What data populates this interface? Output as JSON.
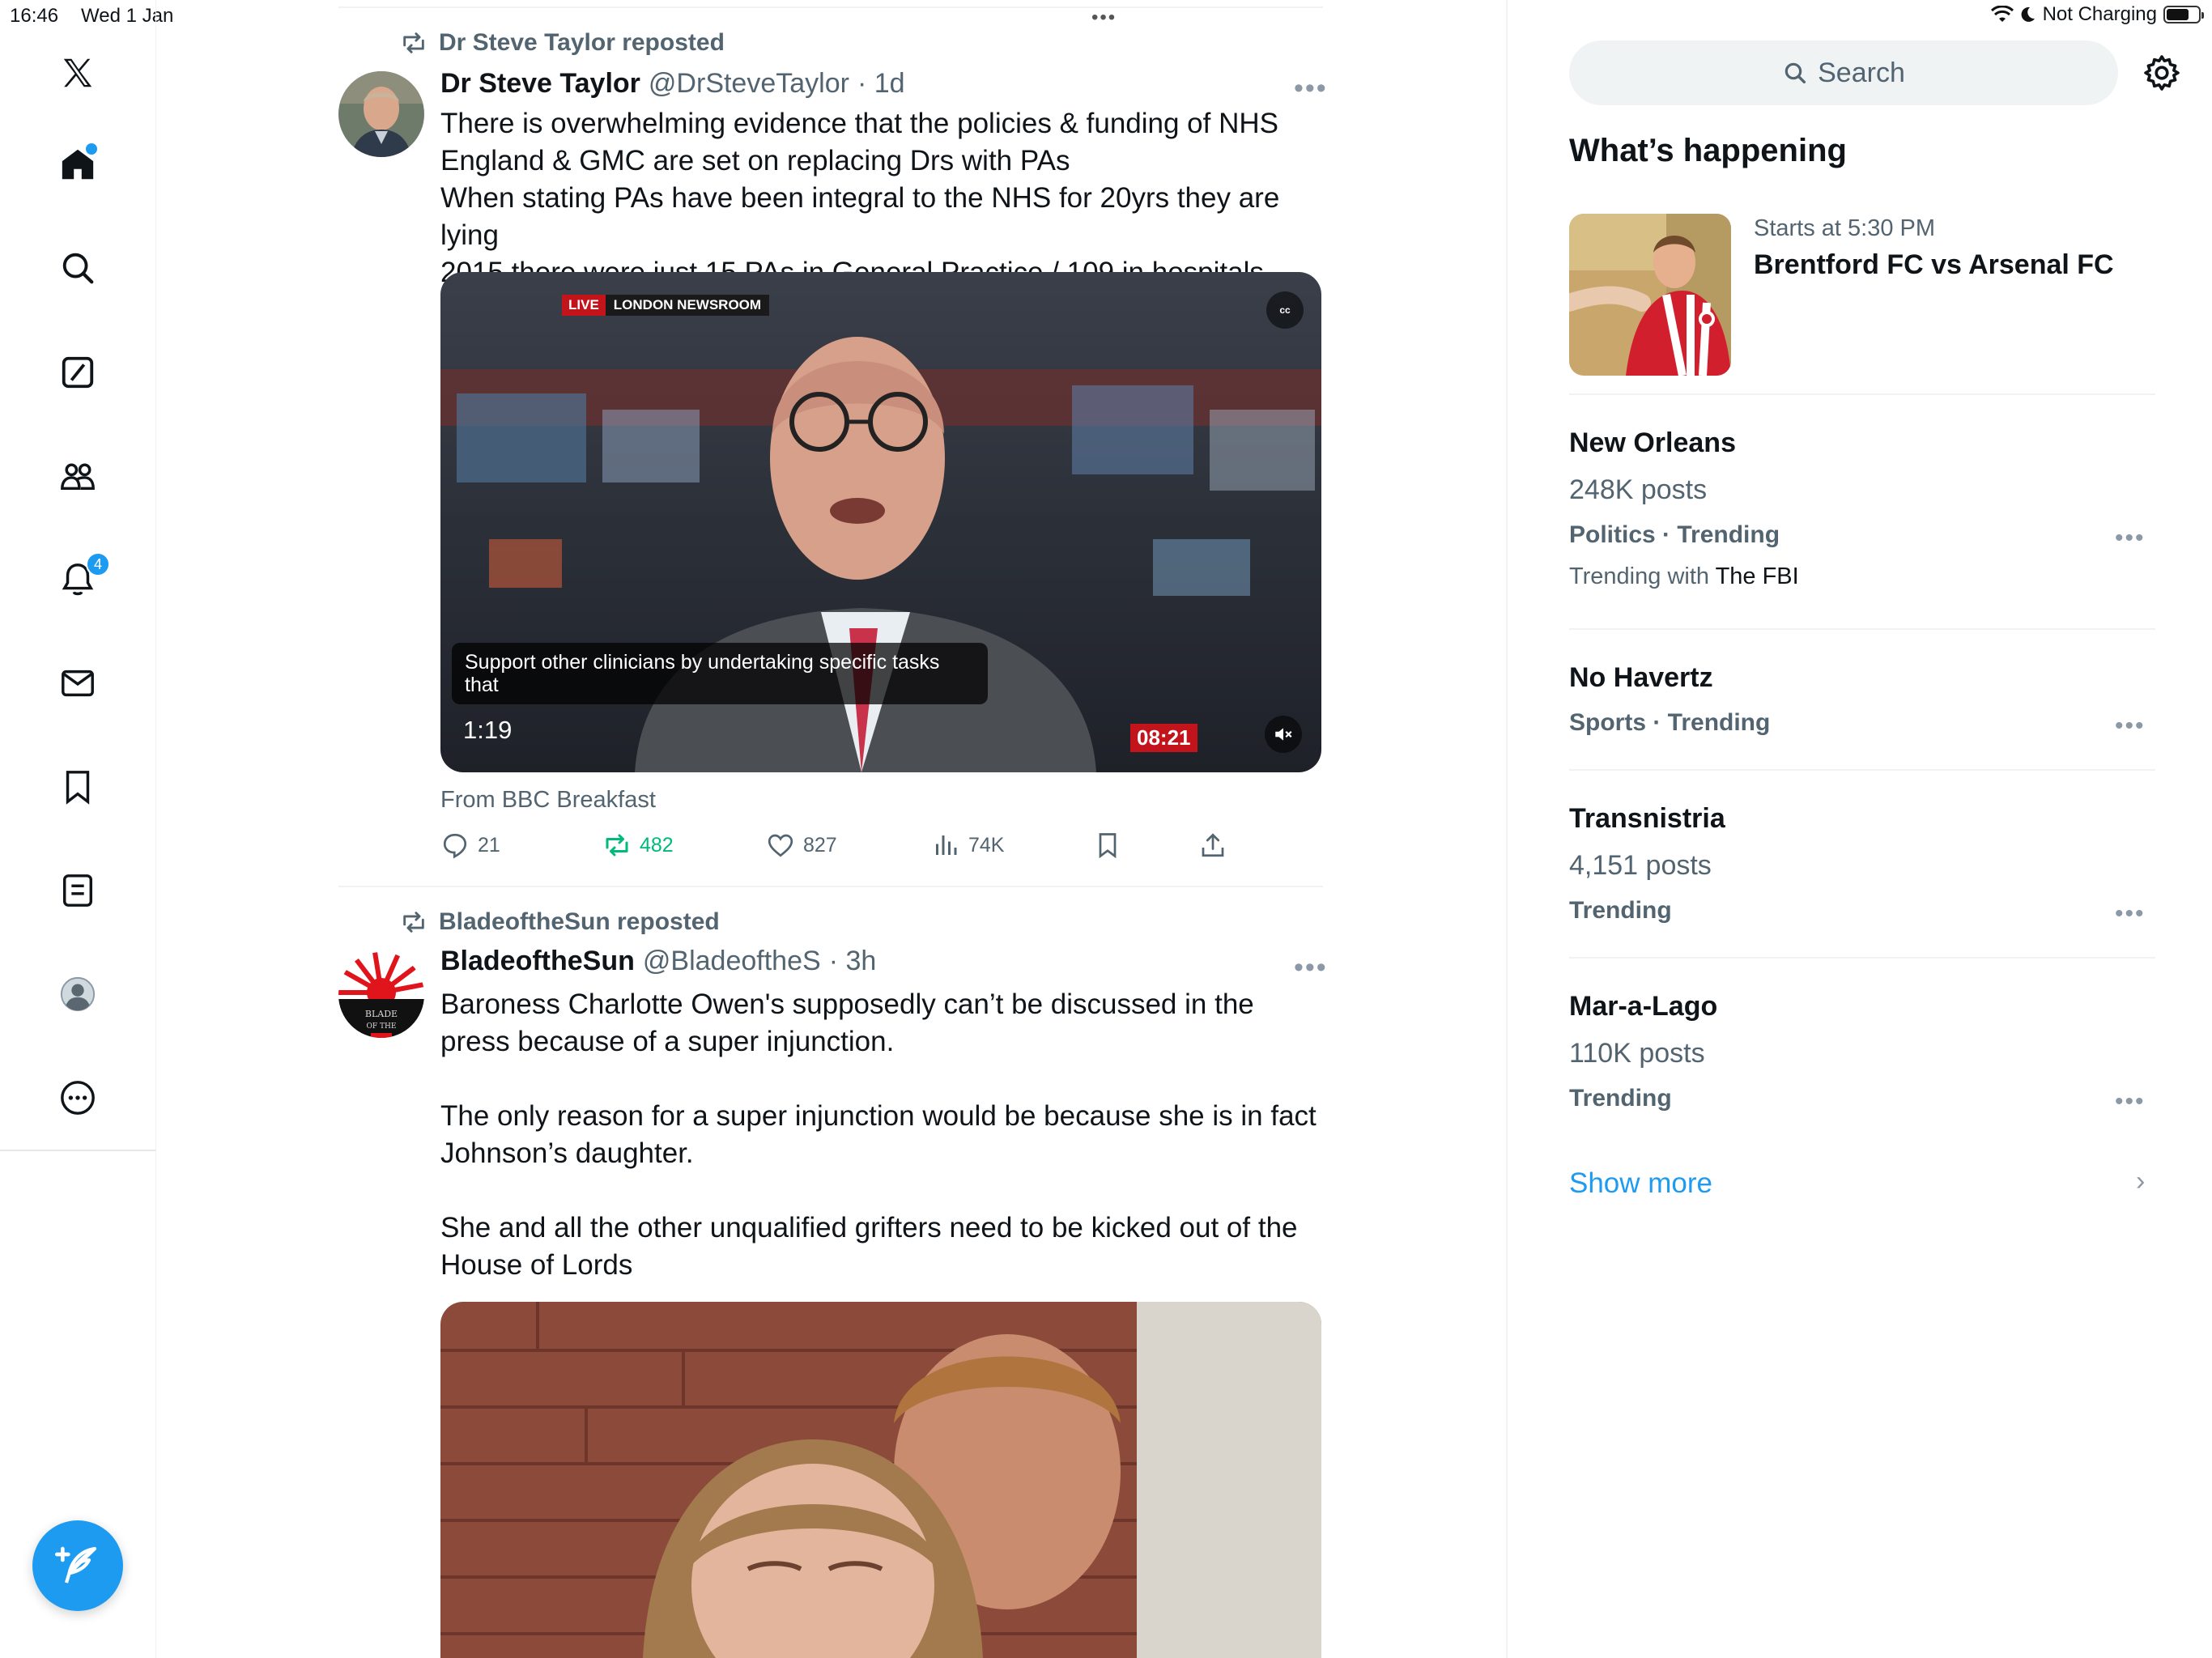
{
  "status_bar": {
    "time": "16:46",
    "date": "Wed 1 Jan",
    "battery_text": "Not Charging"
  },
  "nav": {
    "items": [
      {
        "name": "x-logo-icon"
      },
      {
        "name": "home-icon"
      },
      {
        "name": "search-icon"
      },
      {
        "name": "grok-icon"
      },
      {
        "name": "communities-icon"
      },
      {
        "name": "notifications-icon",
        "badge": "4"
      },
      {
        "name": "messages-icon"
      },
      {
        "name": "bookmarks-icon"
      },
      {
        "name": "lists-icon"
      },
      {
        "name": "profile-icon"
      },
      {
        "name": "more-icon"
      }
    ],
    "compose_icon": "compose-post-icon"
  },
  "feed": {
    "tweets": [
      {
        "repost_label": "Dr Steve Taylor reposted",
        "author": "Dr Steve Taylor",
        "handle": "@DrSteveTaylor",
        "time": "· 1d",
        "text": "There is overwhelming evidence that the policies & funding of NHS England & GMC are set on replacing Drs with PAs\nWhen stating PAs have been integral to the NHS for 20yrs they are lying\n2015 there were just 15 PAs in General Practice / 109 in hospitals",
        "media": {
          "live_label": "LIVE",
          "newsroom_label": "LONDON NEWSROOM",
          "cc_label": "cc",
          "caption": "Support other clinicians by undertaking specific tasks that",
          "timecode": "1:19",
          "clock": "08:21"
        },
        "from_label": "From BBC Breakfast",
        "stats": {
          "replies": "21",
          "reposts": "482",
          "likes": "827",
          "views": "74K"
        }
      },
      {
        "repost_label": "BladeoftheSun reposted",
        "author": "BladeoftheSun",
        "handle": "@BladeoftheS",
        "time": "· 3h",
        "text": "Baroness Charlotte Owen's supposedly can’t be discussed in the press because of a super injunction.\n\nThe only reason for a super injunction would be because she is in fact Johnson’s daughter.\n\nShe and all the other unqualified grifters need to be kicked out of the House of Lords"
      }
    ]
  },
  "sidebar": {
    "search_placeholder": "Search",
    "section_title": "What’s happening",
    "event": {
      "subtitle": "Starts at 5:30 PM",
      "title": "Brentford FC vs Arsenal FC"
    },
    "trends": [
      {
        "title": "New Orleans",
        "posts": "248K posts",
        "category": "Politics · Trending",
        "with_label": "Trending with",
        "with_value": "The FBI"
      },
      {
        "title": "No Havertz",
        "category": "Sports · Trending"
      },
      {
        "title": "Transnistria",
        "posts": "4,151 posts",
        "category": "Trending"
      },
      {
        "title": "Mar-a-Lago",
        "posts": "110K posts",
        "category": "Trending"
      }
    ],
    "show_more": "Show more"
  },
  "colors": {
    "accent": "#1d9bf0",
    "repost_green": "#00ba7c",
    "text_primary": "#0f1419",
    "text_secondary": "#536471",
    "live_red": "#c4141b"
  }
}
